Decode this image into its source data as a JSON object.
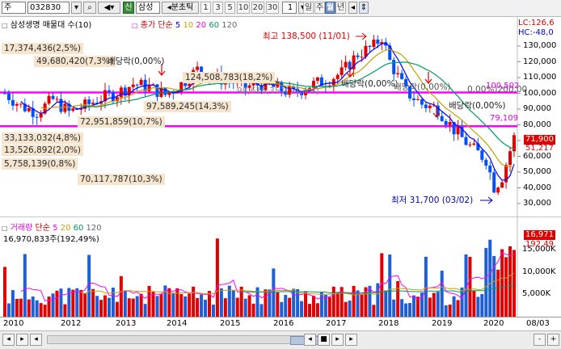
{
  "toolbar": {
    "market": "주",
    "code": "032830",
    "company_badge": "신",
    "company": "삼성",
    "tick_label": "◂분초틱",
    "periods": [
      "1",
      "3",
      "5",
      "10",
      "20",
      "30"
    ],
    "unit_value": "1",
    "dwmy": [
      "일",
      "주",
      "월",
      "년"
    ],
    "active_period": "월"
  },
  "price_panel": {
    "title": "삼성생명 매물대 수(10)",
    "ma_label": "종가 단순",
    "ma_periods": [
      "5",
      "10",
      "20",
      "60",
      "120"
    ],
    "ma_colors": [
      "#0000ff",
      "#c8a000",
      "#ff00ff",
      "#009966",
      "#666666"
    ],
    "legend_lc": "LC:126,6",
    "legend_hc": "HC:-48,0",
    "axis_labels": [
      "130,000",
      "120,000",
      "110,000",
      "100,000",
      "90,000",
      "80,000",
      "70,000",
      "60,000",
      "50,000",
      "40,000",
      "30,000"
    ],
    "current_price_box": "71,900",
    "price_51": "51,217",
    "line_100": "100,502",
    "line_79": "79,109",
    "max_label": "최고 138,500 (11/01)",
    "min_label": "최저 31,700 (03/02)",
    "volume_profile": [
      "17,374,436(2,5%)",
      "49,680,420(7,3%)",
      "124,508,783(18,2%)",
      "98,616,351(14,4%)",
      "97,589,245(14,3%)",
      "72,951,859(10,7%)",
      "33,133,032(4,8%)",
      "13,526,892(2,0%)",
      "5,758,139(0,8%)",
      "70,117,787(10,3%)"
    ],
    "dividend_labels": [
      "배당락(0,00%)",
      "배당락(0,00%)",
      "배당락(0,00%)",
      "배당락(0,00%)",
      "배당락(0,00%)"
    ],
    "overlap_text": "0,00%)200,00"
  },
  "volume_panel": {
    "title": "거래량",
    "ma_label": "단순",
    "ma_periods": [
      "5",
      "20",
      "60",
      "120"
    ],
    "ma_colors": [
      "#ff00ff",
      "#c8a000",
      "#009966",
      "#666666"
    ],
    "last_value": "16,970,833주(192,49%)",
    "box_value": "16,971",
    "box_pct": "192,49",
    "axis_labels": [
      "15,000K",
      "10,000K",
      "5,000K"
    ]
  },
  "x_axis": [
    "2010",
    "2012",
    "2013",
    "2014",
    "2015",
    "2016",
    "2017",
    "2018",
    "2019",
    "2020",
    "08/03"
  ],
  "scrollbar": {
    "left_buttons": [
      "◂",
      "▸",
      "◂"
    ],
    "controls": [
      "◂",
      "■",
      "▸",
      "▸"
    ],
    "zoom": [
      "-",
      "+",
      "A"
    ]
  },
  "chart_data": {
    "type": "candlestick",
    "title": "삼성생명",
    "ylim": [
      25000,
      135000
    ],
    "series": [
      {
        "name": "price",
        "x": [
          2010.0,
          2010.33,
          2010.67,
          2011.0,
          2011.33,
          2011.67,
          2012.0,
          2012.33,
          2012.67,
          2013.0,
          2013.33,
          2013.67,
          2014.0,
          2014.33,
          2014.67,
          2015.0,
          2015.33,
          2015.67,
          2016.0,
          2016.33,
          2016.67,
          2017.0,
          2017.33,
          2017.67,
          2017.83,
          2018.0,
          2018.33,
          2018.67,
          2019.0,
          2019.33,
          2019.67,
          2020.0,
          2020.17,
          2020.33,
          2020.58
        ],
        "values": [
          100000,
          92000,
          88000,
          96000,
          88000,
          92000,
          97000,
          100000,
          106000,
          104000,
          99000,
          106000,
          115000,
          110000,
          108000,
          104000,
          106000,
          103000,
          100000,
          105000,
          108000,
          113000,
          125000,
          130000,
          136000,
          120000,
          101000,
          93000,
          90000,
          77000,
          66000,
          58000,
          40000,
          47000,
          71900
        ]
      }
    ]
  }
}
